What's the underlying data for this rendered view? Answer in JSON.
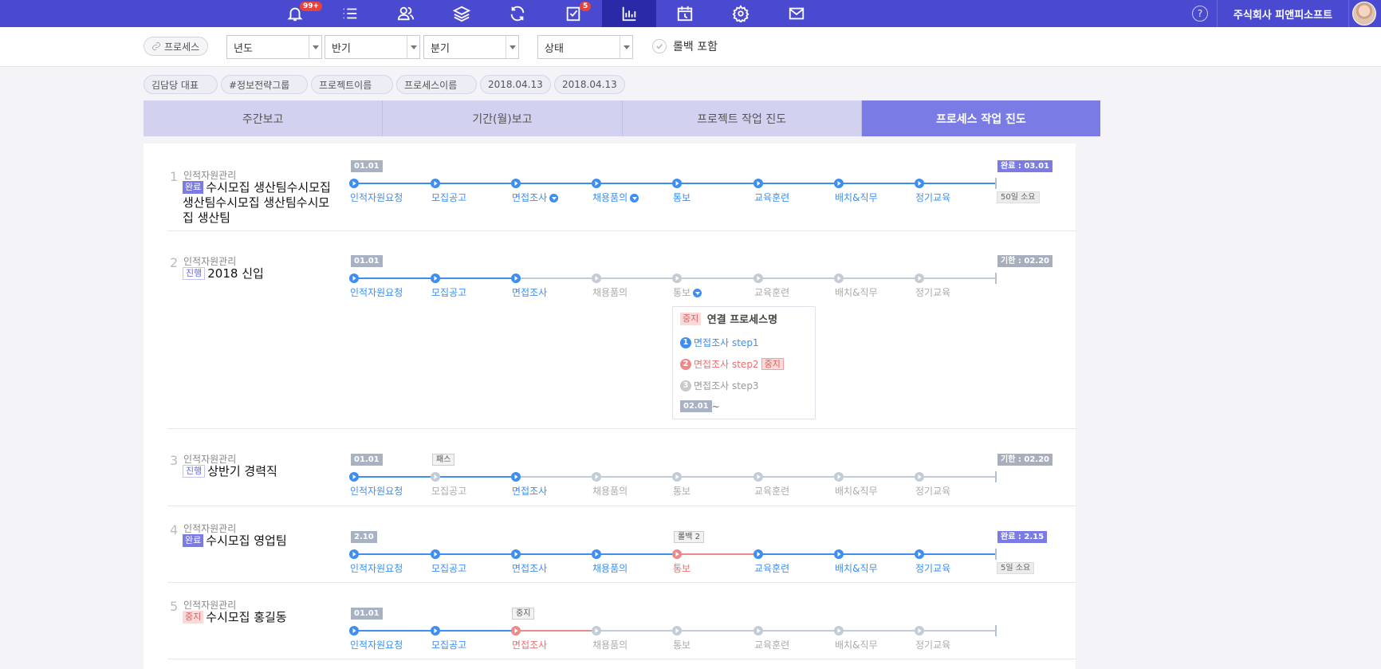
{
  "topbar": {
    "icons": [
      {
        "name": "bell-icon",
        "badge": "99+"
      },
      {
        "name": "list-icon"
      },
      {
        "name": "users-icon"
      },
      {
        "name": "layers-icon"
      },
      {
        "name": "refresh-icon"
      },
      {
        "name": "checklist-icon",
        "badge": "5"
      },
      {
        "name": "bar-chart-icon",
        "active": true
      },
      {
        "name": "calendar-icon"
      },
      {
        "name": "gear-icon"
      },
      {
        "name": "mail-icon"
      }
    ],
    "help": "?",
    "company": "주식회사 피앤피소프트"
  },
  "filters": {
    "process_chip": "프로세스",
    "year": "년도",
    "half": "반기",
    "quarter": "분기",
    "status": "상태",
    "rollback_label": "롤백 포함"
  },
  "tags": [
    "김담당 대표",
    "#정보전략그룹",
    "프로젝트이름",
    "프로세스이름",
    "2018.04.13",
    "2018.04.13"
  ],
  "tabs": [
    "주간보고",
    "기간(월)보고",
    "프로젝트 작업 진도",
    "프로세스 작업 진도"
  ],
  "steps": [
    "인적자원요청",
    "모집공고",
    "면접조사",
    "채용품의",
    "통보",
    "교육훈련",
    "배치&직무",
    "정기교육"
  ],
  "rows": [
    {
      "num": "1",
      "category": "인적자원관리",
      "status": "완료",
      "status_type": "done",
      "title": "수시모집 생산팀수시모집 생산팀수시모집 생산팀수시모집 생산팀",
      "start": "01.01",
      "end_flag": "완료 : 03.01",
      "end_type": "purple",
      "duration": "50일 소요",
      "progress": 8,
      "stop_index": null,
      "step_states": [
        "blue",
        "blue",
        "blue",
        "blue",
        "blue",
        "blue",
        "blue",
        "blue"
      ],
      "dropdowns": [
        2,
        3
      ]
    },
    {
      "num": "2",
      "category": "인적자원관리",
      "status": "진행",
      "status_type": "prog",
      "title": "2018 신입",
      "start": "01.01",
      "end_flag": "기한 : 02.20",
      "end_type": "gray",
      "duration": "",
      "progress": 2,
      "stop_index": null,
      "step_states": [
        "blue",
        "blue",
        "blue",
        "gray",
        "gray",
        "gray",
        "gray",
        "gray"
      ],
      "dropdowns": [
        4
      ]
    },
    {
      "num": "3",
      "category": "인적자원관리",
      "status": "진행",
      "status_type": "prog",
      "title": "상반기 경력직",
      "start": "01.01",
      "end_flag": "기한 : 02.20",
      "end_type": "gray",
      "duration": "",
      "progress": 2,
      "stop_index": null,
      "pass_note": "패스",
      "step_states": [
        "blue",
        "gray",
        "blue",
        "gray",
        "gray",
        "gray",
        "gray",
        "gray"
      ],
      "dropdowns": []
    },
    {
      "num": "4",
      "category": "인적자원관리",
      "status": "완료",
      "status_type": "done",
      "title": "수시모집 영업팀",
      "start": "2.10",
      "end_flag": "완료 : 2.15",
      "end_type": "purple",
      "duration": "5일 소요",
      "progress": 8,
      "stop_index": 4,
      "rollback_note": "롤백 2",
      "step_states": [
        "blue",
        "blue",
        "blue",
        "blue",
        "red",
        "blue",
        "blue",
        "blue"
      ],
      "dropdowns": []
    },
    {
      "num": "5",
      "category": "인적자원관리",
      "status": "중지",
      "status_type": "stop",
      "title": "수시모집 홍길동",
      "start": "01.01",
      "end_flag": "",
      "end_type": "",
      "duration": "",
      "progress": 2,
      "stop_index": 2,
      "stop_note": "중지",
      "step_states": [
        "blue",
        "blue",
        "red",
        "gray",
        "gray",
        "gray",
        "gray",
        "gray"
      ],
      "dropdowns": []
    }
  ],
  "popup": {
    "badge": "중지",
    "title": "연결 프로세스명",
    "items": [
      {
        "n": "1",
        "label": "면접조사 step1",
        "color": "blue"
      },
      {
        "n": "2",
        "label": "면접조사 step2",
        "color": "red",
        "badge": "중지"
      },
      {
        "n": "3",
        "label": "면접조사 step3",
        "color": "gray"
      }
    ],
    "date": "02.01",
    "date_suffix": "~"
  },
  "colors": {
    "accent": "#4a4ad1",
    "blue": "#3d8ef0",
    "red": "#ec8a8a",
    "gray": "#c3ccd6"
  }
}
